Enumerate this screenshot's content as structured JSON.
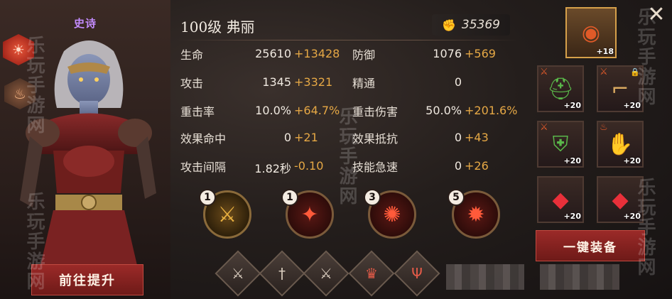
{
  "hero": {
    "rarity": "史诗",
    "title": "100级 弗丽",
    "power": "35369",
    "upgrade_label": "前往提升"
  },
  "stats": [
    {
      "label": "生命",
      "base": "25610",
      "bonus": "+13428"
    },
    {
      "label": "防御",
      "base": "1076",
      "bonus": "+569"
    },
    {
      "label": "攻击",
      "base": "1345",
      "bonus": "+3321"
    },
    {
      "label": "精通",
      "base": "0",
      "bonus": ""
    },
    {
      "label": "重击率",
      "base": "10.0%",
      "bonus": "+64.7%"
    },
    {
      "label": "重击伤害",
      "base": "50.0%",
      "bonus": "+201.6%"
    },
    {
      "label": "效果命中",
      "base": "0",
      "bonus": "+21"
    },
    {
      "label": "效果抵抗",
      "base": "0",
      "bonus": "+43"
    },
    {
      "label": "攻击间隔",
      "base": "1.82秒",
      "bonus": "-0.10"
    },
    {
      "label": "技能急速",
      "base": "0",
      "bonus": "+26"
    }
  ],
  "skills": [
    {
      "level": "1",
      "icon": "golden-sword-icon"
    },
    {
      "level": "1",
      "icon": "fire-beast-icon"
    },
    {
      "level": "3",
      "icon": "fire-orb-icon"
    },
    {
      "level": "5",
      "icon": "fire-sigil-icon"
    }
  ],
  "runes": [
    {
      "icon": "sword-rune-icon"
    },
    {
      "icon": "dagger-rune-icon"
    },
    {
      "icon": "blade-rune-icon"
    },
    {
      "icon": "fire-crown-rune-icon"
    },
    {
      "icon": "trident-rune-icon"
    }
  ],
  "equipment": {
    "amulet": {
      "plus": "+18"
    },
    "helmet": {
      "plus": "+20"
    },
    "pistol": {
      "plus": "+20"
    },
    "armor": {
      "plus": "+20"
    },
    "gauntlet": {
      "plus": "+20"
    },
    "gem1": {
      "plus": "+20"
    },
    "gem2": {
      "plus": "+20"
    }
  },
  "one_click_label": "一键装备",
  "watermark": "乐玩手游网",
  "colors": {
    "bonus": "#e6a845",
    "accent_red": "#9b2a28",
    "rarity": "#c48cff"
  }
}
